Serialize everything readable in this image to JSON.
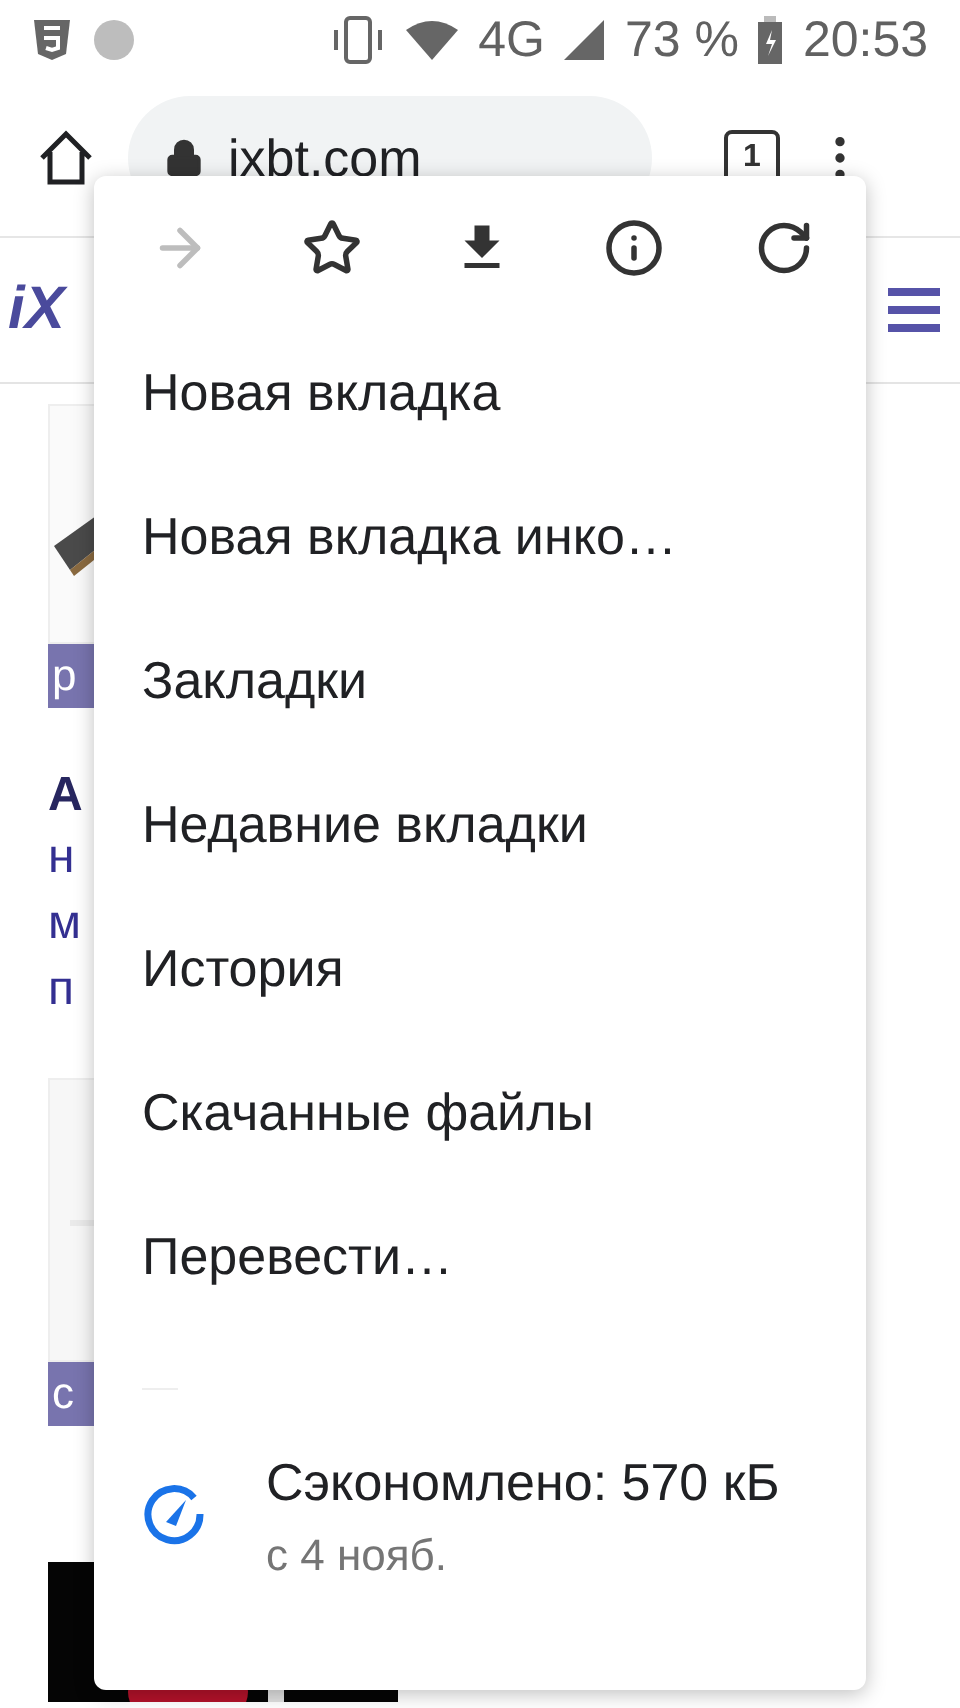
{
  "status_bar": {
    "network": "4G",
    "battery": "73 %",
    "time": "20:53"
  },
  "toolbar": {
    "url": "ixbt.com",
    "tab_count": "1"
  },
  "page": {
    "logo": "iX",
    "cards": [
      {
        "kind": "article",
        "tag": "p",
        "title": "A",
        "lines": [
          "н",
          "м",
          "п"
        ]
      },
      {
        "kind": "blank",
        "tag": "c"
      }
    ]
  },
  "menu": {
    "actions": [
      {
        "kind": "forward",
        "disabled": true
      },
      {
        "kind": "bookmark",
        "disabled": false
      },
      {
        "kind": "download",
        "disabled": false
      },
      {
        "kind": "info",
        "disabled": false
      },
      {
        "kind": "reload",
        "disabled": false
      }
    ],
    "items": [
      "Новая вкладка",
      "Новая вкладка инко…",
      "Закладки",
      "Недавние вкладки",
      "История",
      "Скачанные файлы",
      "Перевести…"
    ],
    "data_saver": {
      "title": "Сэкономлено: 570 кБ",
      "subtitle": "с 4 нояб."
    }
  }
}
